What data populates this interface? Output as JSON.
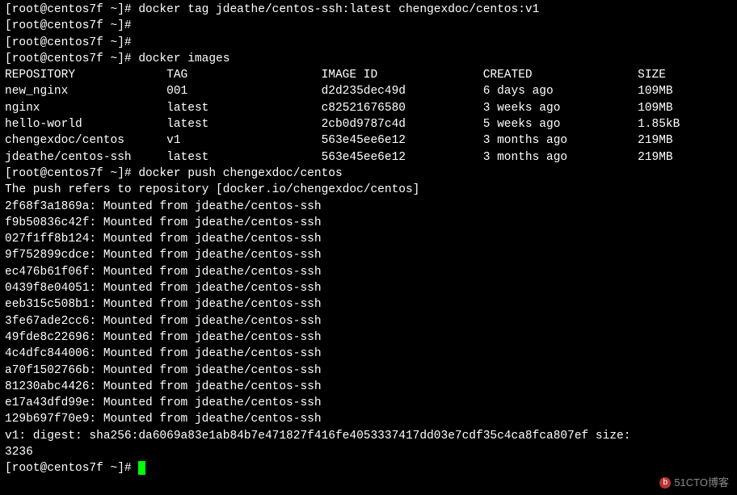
{
  "prompt_user": "root",
  "prompt_host": "centos7f",
  "prompt_dir": "~",
  "prompt_suffix": "#",
  "commands": {
    "tag": "docker tag jdeathe/centos-ssh:latest chengexdoc/centos:v1",
    "empty1": "",
    "empty2": "",
    "images": "docker images",
    "push": "docker push chengexdoc/centos",
    "final": ""
  },
  "images_header": {
    "repo": "REPOSITORY",
    "tag": "TAG",
    "id": "IMAGE ID",
    "created": "CREATED",
    "size": "SIZE"
  },
  "images_rows": [
    {
      "repo": "new_nginx",
      "tag": "001",
      "id": "d2d235dec49d",
      "created": "6 days ago",
      "size": "109MB"
    },
    {
      "repo": "nginx",
      "tag": "latest",
      "id": "c82521676580",
      "created": "3 weeks ago",
      "size": "109MB"
    },
    {
      "repo": "hello-world",
      "tag": "latest",
      "id": "2cb0d9787c4d",
      "created": "5 weeks ago",
      "size": "1.85kB"
    },
    {
      "repo": "chengexdoc/centos",
      "tag": "v1",
      "id": "563e45ee6e12",
      "created": "3 months ago",
      "size": "219MB"
    },
    {
      "repo": "jdeathe/centos-ssh",
      "tag": "latest",
      "id": "563e45ee6e12",
      "created": "3 months ago",
      "size": "219MB"
    }
  ],
  "push_refers": "The push refers to repository [docker.io/chengexdoc/centos]",
  "layers": [
    {
      "hash": "2f68f3a1869a",
      "status": "Mounted from jdeathe/centos-ssh"
    },
    {
      "hash": "f9b50836c42f",
      "status": "Mounted from jdeathe/centos-ssh"
    },
    {
      "hash": "027f1ff8b124",
      "status": "Mounted from jdeathe/centos-ssh"
    },
    {
      "hash": "9f752899cdce",
      "status": "Mounted from jdeathe/centos-ssh"
    },
    {
      "hash": "ec476b61f06f",
      "status": "Mounted from jdeathe/centos-ssh"
    },
    {
      "hash": "0439f8e04051",
      "status": "Mounted from jdeathe/centos-ssh"
    },
    {
      "hash": "eeb315c508b1",
      "status": "Mounted from jdeathe/centos-ssh"
    },
    {
      "hash": "3fe67ade2cc6",
      "status": "Mounted from jdeathe/centos-ssh"
    },
    {
      "hash": "49fde8c22696",
      "status": "Mounted from jdeathe/centos-ssh"
    },
    {
      "hash": "4c4dfc844006",
      "status": "Mounted from jdeathe/centos-ssh"
    },
    {
      "hash": "a70f1502766b",
      "status": "Mounted from jdeathe/centos-ssh"
    },
    {
      "hash": "81230abc4426",
      "status": "Mounted from jdeathe/centos-ssh"
    },
    {
      "hash": "e17a43dfd99e",
      "status": "Mounted from jdeathe/centos-ssh"
    },
    {
      "hash": "129b697f70e9",
      "status": "Mounted from jdeathe/centos-ssh"
    }
  ],
  "digest_line1": "v1: digest: sha256:da6069a83e1ab84b7e471827f416fe4053337417dd03e7cdf35c4ca8fca807ef size:",
  "digest_line2": "3236",
  "watermark": "51CTO博客"
}
